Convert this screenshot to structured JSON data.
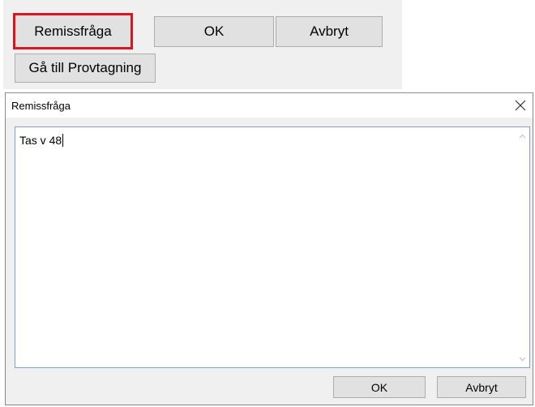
{
  "toolbar": {
    "remiss_label": "Remissfråga",
    "ok_label": "OK",
    "avbryt_label": "Avbryt",
    "provtagning_label": "Gå till Provtagning"
  },
  "dialog": {
    "title": "Remissfråga",
    "close_icon": "close-icon",
    "text_value": "Tas v 48",
    "ok_label": "OK",
    "avbryt_label": "Avbryt"
  },
  "colors": {
    "highlight": "#e0141e",
    "focus_border": "#7a9fd0"
  }
}
